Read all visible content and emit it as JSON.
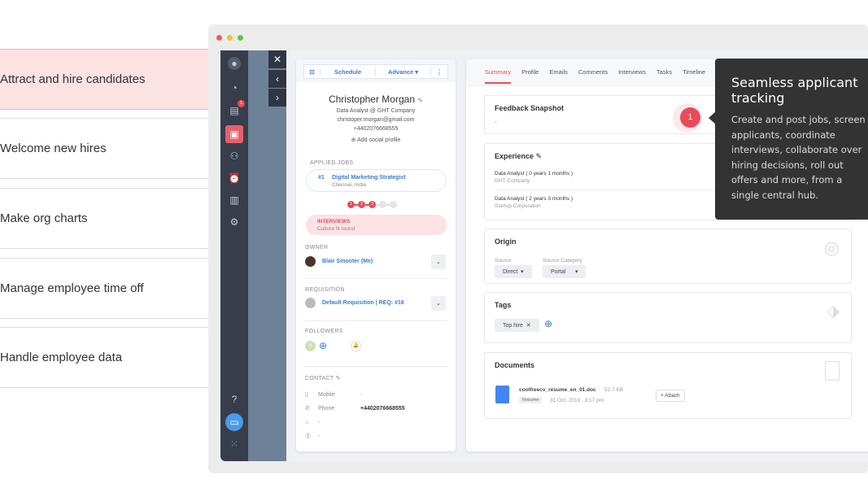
{
  "features": [
    {
      "label": "Attract and hire candidates",
      "active": true
    },
    {
      "label": "Welcome new hires"
    },
    {
      "label": "Make org charts"
    },
    {
      "label": "Manage employee time off"
    },
    {
      "label": "Handle employee data"
    }
  ],
  "sidebar": {
    "badge": "1",
    "icons": [
      "avatar-icon",
      "dashboard-icon",
      "inbox-icon",
      "briefcase-icon",
      "people-icon",
      "alarm-icon",
      "report-icon",
      "settings-icon",
      "help-icon",
      "chat-icon",
      "apps-grid-icon"
    ]
  },
  "candidate": {
    "toolbar": {
      "schedule": "Schedule",
      "advance": "Advance ▾",
      "more": "⋮"
    },
    "name": "Christopher Morgan",
    "title": "Data Analyst @ GHT Company",
    "email": "christoper.morgan@gmail.com",
    "phone": "+4402076668555",
    "add_social": "Add social profile",
    "applied_jobs_label": "APPLIED JOBS",
    "job": {
      "num": "#1",
      "title": "Digital Marketing Strategist",
      "location": "Chennai, India"
    },
    "stages": [
      "1",
      "2",
      "3",
      "",
      ""
    ],
    "stage_status": {
      "title": "INTERVIEWS",
      "sub": "Culture fit round"
    },
    "owner_label": "OWNER",
    "owner": "Blair Smooter (Me)",
    "requisition_label": "REQUISITION",
    "requisition": "Default Requisition | REQ: #16",
    "followers_label": "FOLLOWERS",
    "follower_initial": "A",
    "contact_label": "CONTACT",
    "contact": [
      {
        "label": "Mobile",
        "value": "-"
      },
      {
        "label": "Phone",
        "value": "+4402076668555"
      },
      {
        "label": "",
        "value": "-"
      },
      {
        "label": "",
        "value": "-"
      }
    ]
  },
  "tabs": [
    "Summary",
    "Profile",
    "Emails",
    "Comments",
    "Interviews",
    "Tasks",
    "Timeline"
  ],
  "summary": {
    "feedback": {
      "title": "Feedback Snapshot",
      "value": "-"
    },
    "experience": {
      "title": "Experience",
      "items": [
        {
          "role": "Data Analyst ( 0 years 1 months )",
          "company": "GHT Company"
        },
        {
          "role": "Data Analyst ( 2 years 3 months )",
          "company": "Startup Corporation"
        }
      ]
    },
    "origin": {
      "title": "Origin",
      "source_label": "Source",
      "source": "Direct",
      "category_label": "Source Category",
      "category": "Portal"
    },
    "tags": {
      "title": "Tags",
      "items": [
        "Top hire"
      ]
    },
    "documents": {
      "title": "Documents",
      "file": "coolfreecv_resume_en_01.doc",
      "size": "52.7 KB",
      "tag": "Resume",
      "date": "31 Oct, 2019 , 3:17 pm",
      "attach": "+ Attach"
    }
  },
  "tooltip": {
    "step": "1",
    "title": "Seamless applicant tracking",
    "body": "Create and post jobs, screen applicants, coordinate interviews, collaborate over hiring decisions, roll out offers and more, from a single central hub."
  },
  "colors": {
    "accent": "#e84c5a",
    "link": "#3a7bd5",
    "sidebar": "#373d4a",
    "tooltip": "#333333"
  }
}
